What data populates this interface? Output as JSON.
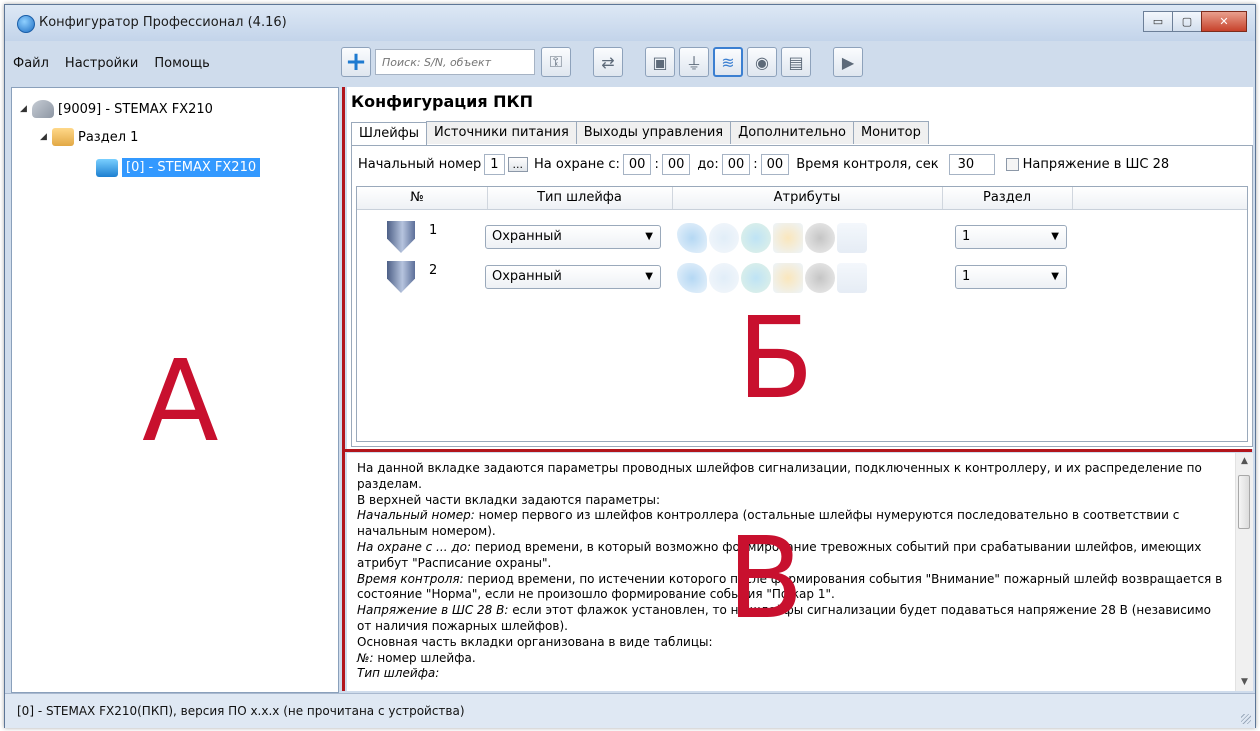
{
  "window": {
    "title": "Конфигуратор Профессионал (4.16)",
    "buttons": {
      "minimize": "▭",
      "maximize": "▢",
      "close": "✕"
    }
  },
  "menu": [
    "Файл",
    "Настройки",
    "Помощь"
  ],
  "toolbar": {
    "search_placeholder": "Поиск: S/N, объект",
    "add_icon": "+",
    "play_icon": "▶"
  },
  "tree": {
    "root": "[9009] - STEMAX FX210",
    "section": "Раздел 1",
    "device": "[0] - STEMAX FX210",
    "arrow": "◢"
  },
  "labels": {
    "a": "А",
    "b": "Б",
    "v": "В"
  },
  "config": {
    "title": "Конфигурация ПКП",
    "tabs": [
      "Шлейфы",
      "Источники питания",
      "Выходы управления",
      "Дополнительно",
      "Монитор"
    ],
    "params": {
      "start_label": "Начальный номер",
      "start_value": "1",
      "dots": "...",
      "armed_from_label": "На охране с:",
      "from_h": "00",
      "from_m": "00",
      "sep": ":",
      "to_label": "до:",
      "to_h": "00",
      "to_m": "00",
      "control_label": "Время контроля, сек",
      "control_value": "30",
      "voltage_label": "Напряжение в ШС 28"
    },
    "columns": [
      "№",
      "Тип шлейфа",
      "Атрибуты",
      "Раздел"
    ],
    "rows": [
      {
        "num": "1",
        "type": "Охранный",
        "section": "1"
      },
      {
        "num": "2",
        "type": "Охранный",
        "section": "1"
      }
    ],
    "dd_arrow": "▼"
  },
  "description": [
    {
      "i": "",
      "t": " На данной вкладке задаются параметры проводных шлейфов сигнализации, подключенных к контроллеру, и их распределение по разделам."
    },
    {
      "i": "",
      "t": "  В верхней части вкладки задаются параметры:"
    },
    {
      "i": "    Начальный номер:",
      "t": " номер первого из шлейфов контроллера (остальные шлейфы нумеруются последовательно в соответствии с начальным номером)."
    },
    {
      "i": "    На охране с ... до:",
      "t": " период времени, в который возможно формирование тревожных событий при срабатывании шлейфов, имеющих атрибут \"Расписание охраны\"."
    },
    {
      "i": "    Время контроля:",
      "t": " период времени, по истечении которого после формирования события \"Внимание\" пожарный шлейф возвращается в состояние \"Норма\", если не произошло формирование события \"Пожар 1\"."
    },
    {
      "i": "    Напряжение в ШС 28 В:",
      "t": " если этот флажок установлен, то на шлейфы сигнализации будет подаваться напряжение 28 В (независимо от наличия пожарных шлейфов)."
    },
    {
      "i": "",
      "t": "  Основная часть вкладки организована в виде таблицы:"
    },
    {
      "i": "    №:",
      "t": " номер шлейфа."
    },
    {
      "i": "    Тип шлейфа:",
      "t": ""
    }
  ],
  "status": "[0] - STEMAX FX210(ПКП), версия ПО x.x.x (не прочитана с устройства)"
}
